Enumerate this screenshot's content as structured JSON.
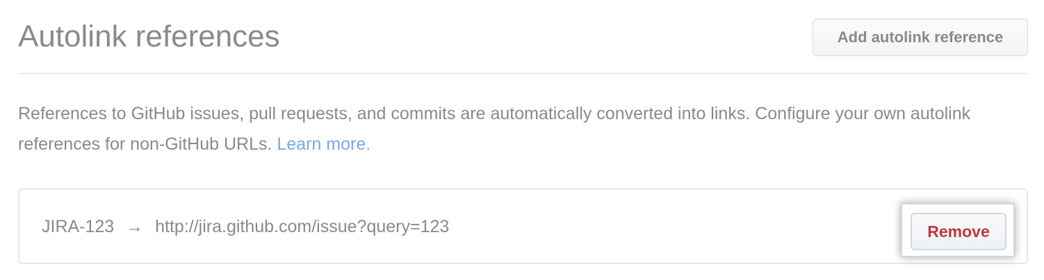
{
  "header": {
    "title": "Autolink references",
    "add_button": "Add autolink reference"
  },
  "description": {
    "text": "References to GitHub issues, pull requests, and commits are automatically converted into links. Configure your own autolink references for non-GitHub URLs.",
    "learn_more": "Learn more."
  },
  "autolinks": [
    {
      "prefix": "JIRA-123",
      "arrow": "→",
      "url": "http://jira.github.com/issue?query=123",
      "remove_label": "Remove"
    }
  ],
  "colors": {
    "link": "#7aa7e6",
    "danger": "#c0383c"
  }
}
